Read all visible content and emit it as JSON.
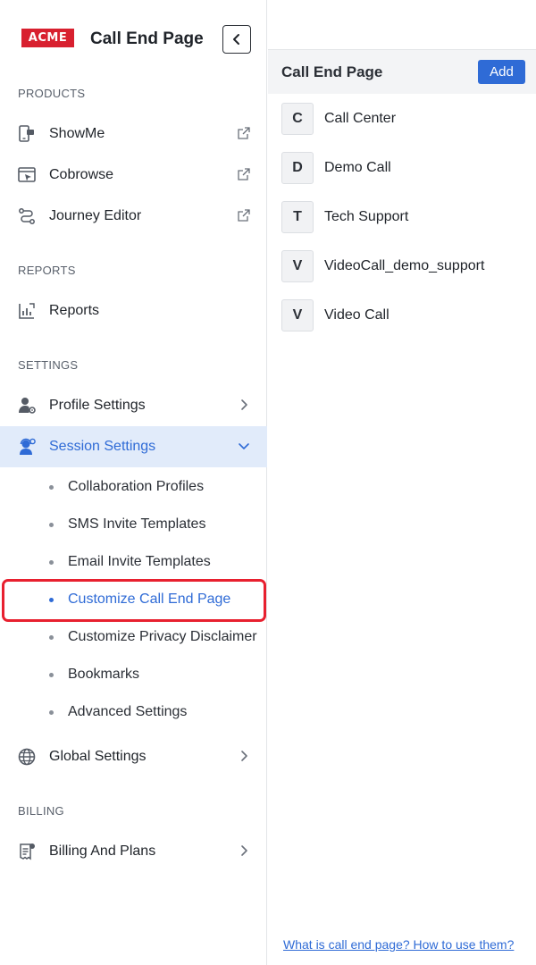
{
  "brand": {
    "logo_text": "ACME",
    "title": "Call End Page"
  },
  "sections": {
    "products": "PRODUCTS",
    "reports": "REPORTS",
    "settings": "SETTINGS",
    "billing": "BILLING"
  },
  "nav": {
    "showme": "ShowMe",
    "cobrowse": "Cobrowse",
    "journey_editor": "Journey Editor",
    "reports": "Reports",
    "profile_settings": "Profile Settings",
    "session_settings": "Session Settings",
    "global_settings": "Global Settings",
    "billing_and_plans": "Billing And Plans"
  },
  "session_sub": [
    {
      "label": "Collaboration Profiles"
    },
    {
      "label": "SMS Invite Templates"
    },
    {
      "label": "Email Invite Templates"
    },
    {
      "label": "Customize Call End Page"
    },
    {
      "label": "Customize Privacy Disclaimer"
    },
    {
      "label": "Bookmarks"
    },
    {
      "label": "Advanced Settings"
    }
  ],
  "selected_sub": "Customize Call End Page",
  "panel": {
    "title": "Call End Page",
    "add_label": "Add",
    "pages": [
      {
        "initial": "C",
        "name": "Call Center"
      },
      {
        "initial": "D",
        "name": "Demo Call"
      },
      {
        "initial": "T",
        "name": "Tech Support"
      },
      {
        "initial": "V",
        "name": "VideoCall_demo_support"
      },
      {
        "initial": "V",
        "name": "Video Call"
      }
    ],
    "help_link": "What is call end page? How to use them?"
  },
  "colors": {
    "accent": "#2f6bd6",
    "brand_red": "#d8202f",
    "active_bg": "#e1ebfa",
    "highlight": "#e8202f"
  },
  "icons": {
    "showme": "phone-screen-icon",
    "cobrowse": "browser-cursor-icon",
    "journey_editor": "journey-route-icon",
    "reports": "report-chart-icon",
    "profile_settings": "user-gear-icon",
    "session_settings": "agent-headset-icon",
    "global_settings": "globe-icon",
    "billing_and_plans": "receipt-icon",
    "external_link": "external-link-icon"
  }
}
